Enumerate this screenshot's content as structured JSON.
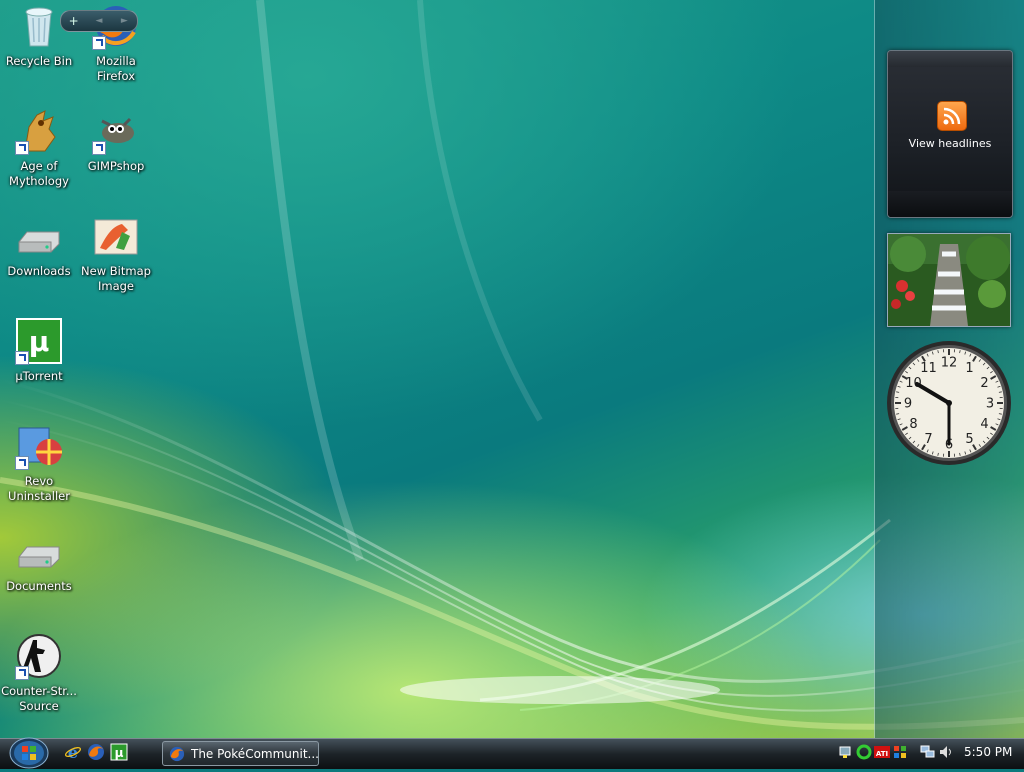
{
  "desktop": {
    "icons": [
      {
        "label": "Recycle Bin",
        "icon": "recycle-bin-icon"
      },
      {
        "label": "Mozilla\nFirefox",
        "icon": "firefox-icon"
      },
      {
        "label": "Age of\nMythology",
        "icon": "age-of-mythology-icon"
      },
      {
        "label": "GIMPshop",
        "icon": "gimpshop-icon"
      },
      {
        "label": "Downloads",
        "icon": "drive-icon"
      },
      {
        "label": "New Bitmap\nImage",
        "icon": "bitmap-image-icon"
      },
      {
        "label": "µTorrent",
        "icon": "utorrent-icon"
      },
      {
        "label": "Revo\nUninstaller",
        "icon": "revo-uninstaller-icon"
      },
      {
        "label": "Documents",
        "icon": "drive-icon"
      },
      {
        "label": "Counter-Str...\nSource",
        "icon": "counter-strike-icon"
      }
    ]
  },
  "sidebar": {
    "controls": {
      "add": "+",
      "prev": "◄",
      "next": "►"
    },
    "feed_gadget": {
      "text": "View headlines",
      "icon": "rss-icon",
      "color": "#f07a1a"
    },
    "slideshow_gadget": {
      "icon": "waterfall-photo"
    },
    "clock_gadget": {
      "numbers": [
        "12",
        "1",
        "2",
        "3",
        "4",
        "5",
        "6",
        "7",
        "8",
        "9",
        "10",
        "11"
      ],
      "time": "5:50"
    }
  },
  "taskbar": {
    "start_icon": "windows-start-orb",
    "quick_launch": [
      "internet-explorer-icon",
      "firefox-icon",
      "utorrent-icon"
    ],
    "tasks": [
      {
        "label": "The PokéCommunit...",
        "icon": "firefox-icon"
      }
    ],
    "tray_icons": [
      "network-status-icon",
      "green-circle-icon",
      "ati-icon",
      "windows-flag-icon",
      "network-icon",
      "volume-icon"
    ],
    "clock": "5:50 PM"
  }
}
